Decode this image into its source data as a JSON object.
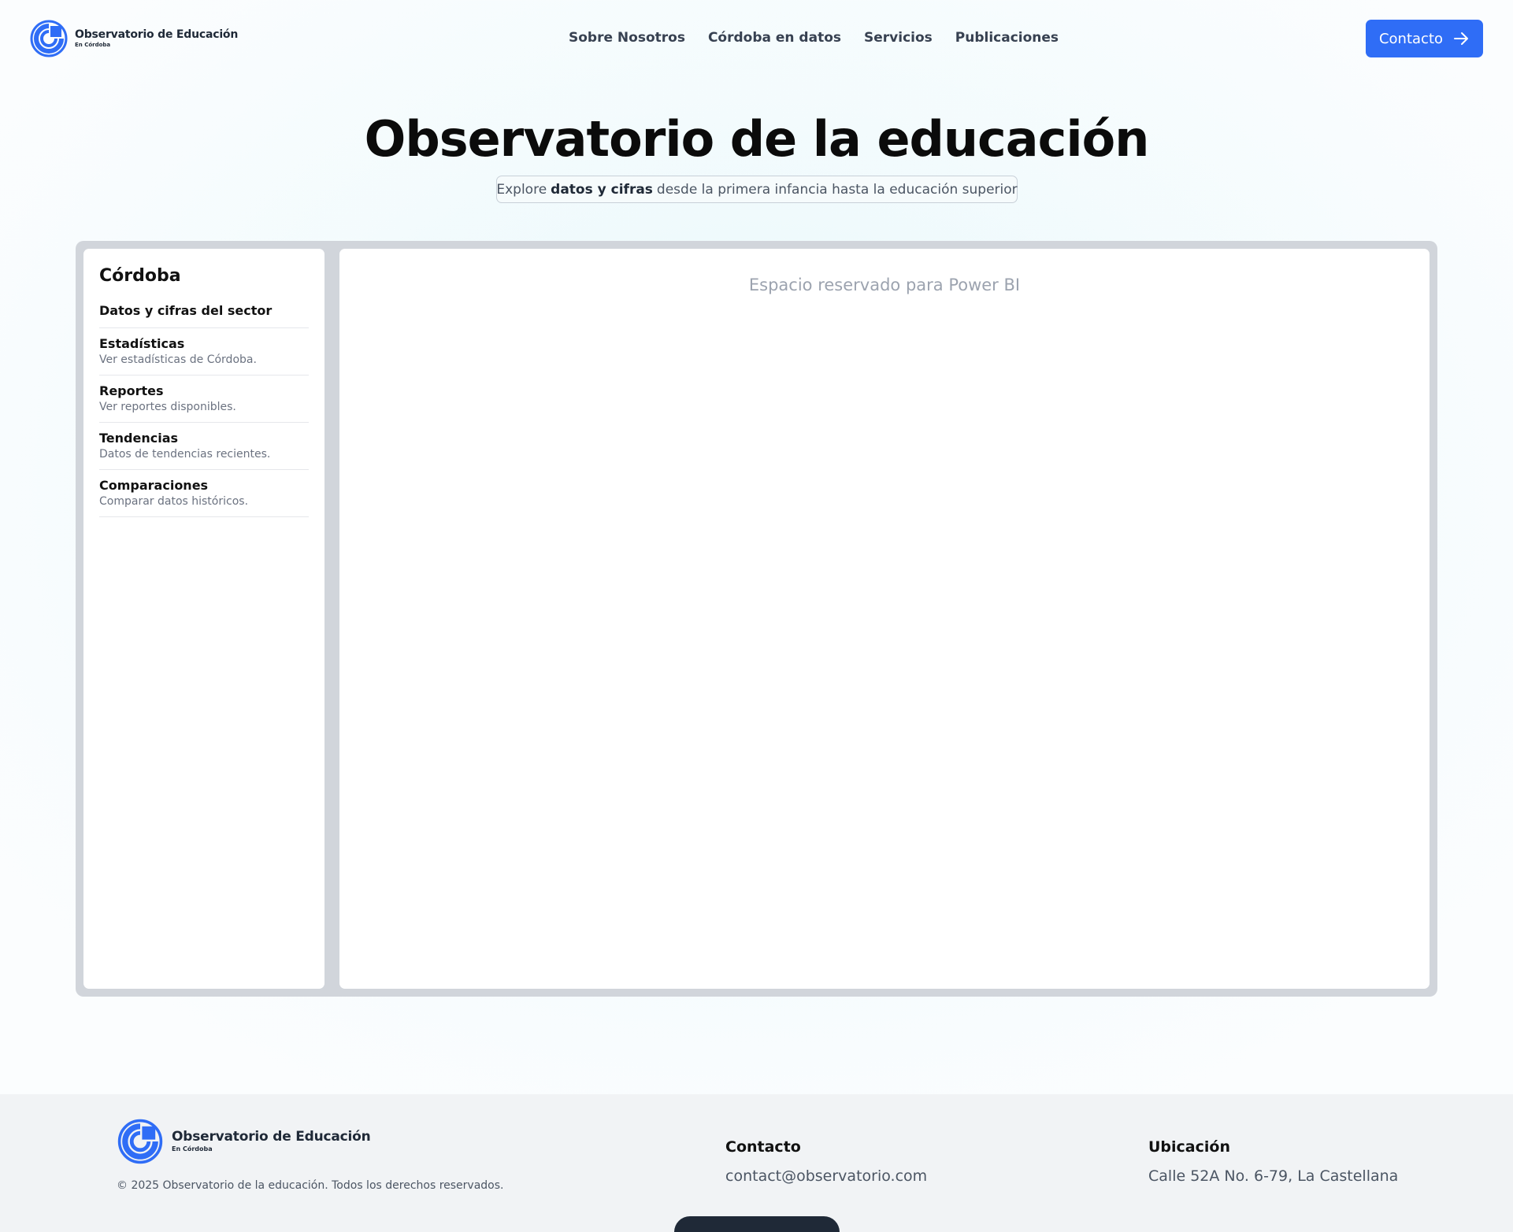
{
  "header": {
    "logo": {
      "title": "Observatorio de Educación",
      "subtitle": "En Córdoba"
    },
    "nav": [
      "Sobre Nosotros",
      "Córdoba en datos",
      "Servicios",
      "Publicaciones"
    ],
    "contact_button": "Contacto",
    "contact_icon": "arrow-right-icon",
    "accent_color": "#2f6df6"
  },
  "hero": {
    "title": "Observatorio de la educación",
    "pill_prefix": "Explore",
    "pill_bold": "datos y cifras",
    "pill_suffix": "desde la primera infancia hasta la educación superior"
  },
  "sidebar": {
    "title": "Córdoba",
    "heading": "Datos y cifras del sector",
    "items": [
      {
        "title": "Estadísticas",
        "desc": "Ver estadísticas de Córdoba."
      },
      {
        "title": "Reportes",
        "desc": "Ver reportes disponibles."
      },
      {
        "title": "Tendencias",
        "desc": "Datos de tendencias recientes."
      },
      {
        "title": "Comparaciones",
        "desc": "Comparar datos históricos."
      }
    ]
  },
  "panel": {
    "placeholder": "Espacio reservado para Power BI"
  },
  "footer": {
    "logo": {
      "title": "Observatorio de Educación",
      "subtitle": "En Córdoba"
    },
    "copyright": "© 2025 Observatorio de la educación. Todos los derechos reservados.",
    "contact_heading": "Contacto",
    "contact_email": "contact@observatorio.com",
    "location_heading": "Ubicación",
    "location_address": "Calle 52A No. 6-79, La Castellana"
  }
}
